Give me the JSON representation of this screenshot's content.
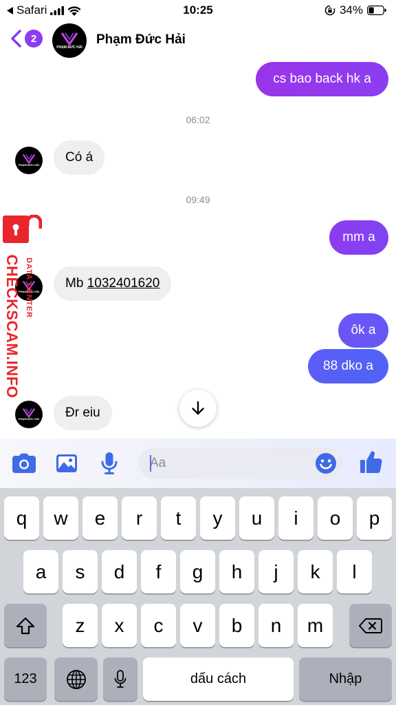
{
  "status_bar": {
    "back_app": "Safari",
    "time": "10:25",
    "battery": "34%"
  },
  "header": {
    "unread_count": "2",
    "contact_name": "Phạm Đức Hải",
    "avatar_name": "PHẠM ĐỨC HẢI"
  },
  "messages": [
    {
      "direction": "out",
      "text": "cs bao back hk a"
    },
    {
      "timestamp": "06:02"
    },
    {
      "direction": "in",
      "text": "Có á"
    },
    {
      "timestamp": "09:49"
    },
    {
      "direction": "out",
      "text": "mm a"
    },
    {
      "direction": "in",
      "prefix": "Mb",
      "phone": "1032401620"
    },
    {
      "direction": "out",
      "text": "ôk a"
    },
    {
      "direction": "out",
      "text": "88 dko a"
    },
    {
      "direction": "in",
      "text": "Đr eiu"
    }
  ],
  "watermark": {
    "site": "CHECKSCAM.INFO",
    "sub": "DATA CENTER"
  },
  "composer": {
    "placeholder": "Aa"
  },
  "keyboard": {
    "row1": [
      "q",
      "w",
      "e",
      "r",
      "t",
      "y",
      "u",
      "i",
      "o",
      "p"
    ],
    "row2": [
      "a",
      "s",
      "d",
      "f",
      "g",
      "h",
      "j",
      "k",
      "l"
    ],
    "row3": [
      "z",
      "x",
      "c",
      "v",
      "b",
      "n",
      "m"
    ],
    "numbers_key": "123",
    "space_label": "dấu cách",
    "return_label": "Nhập"
  },
  "colors": {
    "accent": "#8a3df0",
    "bubble_out_gradient": [
      "#a033ea",
      "#4f63f6"
    ],
    "bubble_in": "#eeeff1",
    "icon_blue": "#3f6be8",
    "watermark_red": "#e8262b"
  },
  "icons": [
    "signal-icon",
    "wifi-icon",
    "rotation-lock-icon",
    "battery-icon",
    "back-chevron-icon",
    "arrow-down-icon",
    "camera-icon",
    "image-icon",
    "mic-icon",
    "emoji-icon",
    "like-icon",
    "shift-icon",
    "backspace-icon",
    "globe-icon",
    "dictation-icon",
    "lock-icon"
  ]
}
